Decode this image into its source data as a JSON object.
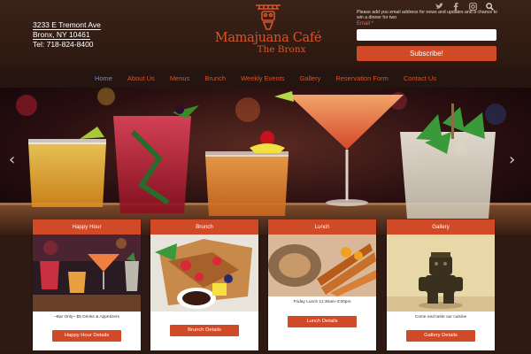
{
  "contact": {
    "street": "3233 E Tremont Ave",
    "city": "Bronx, NY 10461",
    "phone": "Tel: 718-824-8400"
  },
  "brand": {
    "name": "Mamajuana Café",
    "sub": "The Bronx",
    "accent": "#d14a28"
  },
  "social": {
    "icons": [
      "twitter-icon",
      "facebook-icon",
      "instagram-icon",
      "search-icon"
    ]
  },
  "signup": {
    "prompt": "Please add you email address for news and updates and a chance to win a dinner for two",
    "email_label": "Email *",
    "email_value": "",
    "button": "Subscribe!"
  },
  "nav": {
    "items": [
      "Home",
      "About Us",
      "Menus",
      "Brunch",
      "Weekly Events",
      "Gallery",
      "Reservation Form",
      "Contact Us"
    ],
    "active": "Home"
  },
  "hero": {
    "prev": "‹",
    "next": "›"
  },
  "cards": [
    {
      "title": "Happy Hour",
      "text": "~Bar Only~ $5 Drinks & Appetizers",
      "button": "Happy Hour Details"
    },
    {
      "title": "Brunch",
      "text": "",
      "button": "Brunch Details"
    },
    {
      "title": "Lunch",
      "text": "Friday Lunch 11:30am-3:00pm",
      "button": "Lunch Details"
    },
    {
      "title": "Gallery",
      "text": "Come and taste our cuisine",
      "button": "Gallery Details"
    }
  ]
}
